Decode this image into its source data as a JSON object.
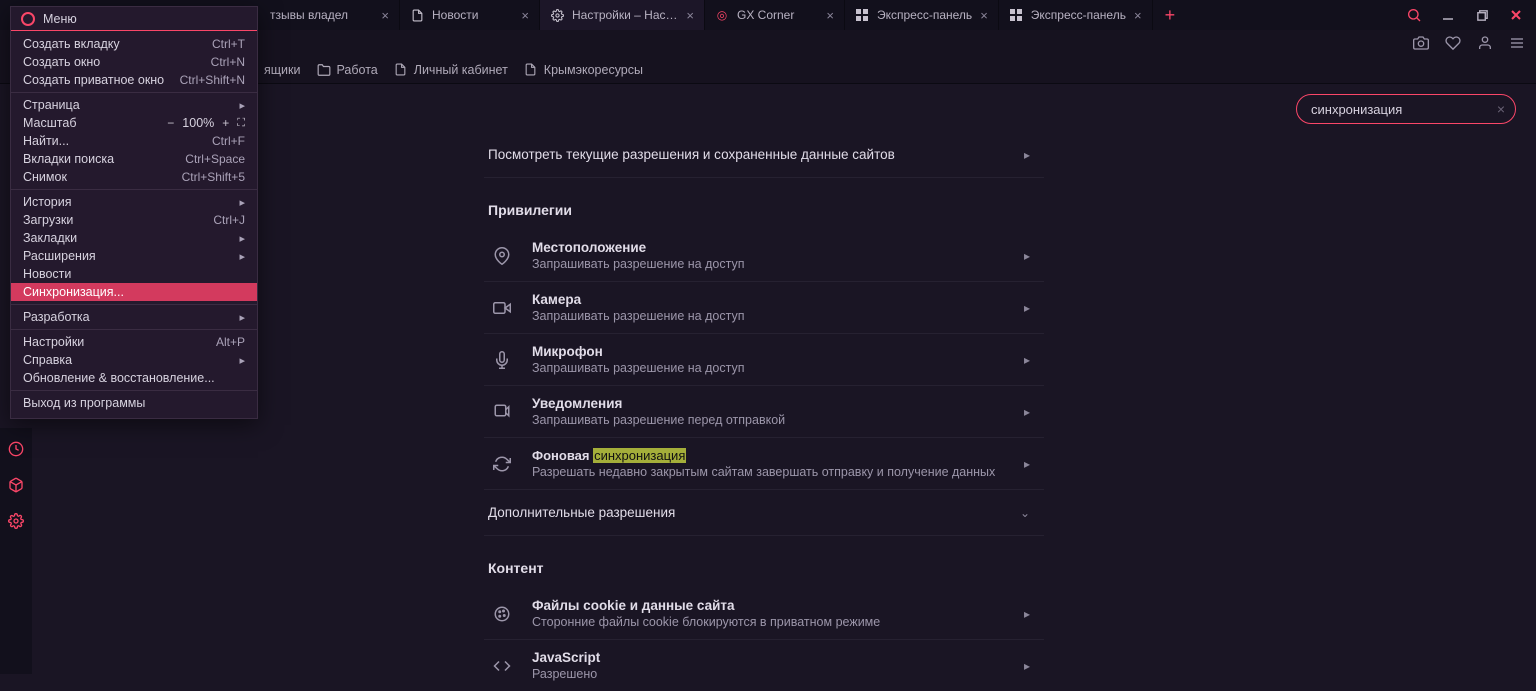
{
  "tabs": [
    {
      "title": "тзывы владел",
      "icon": "page"
    },
    {
      "title": "Новости",
      "icon": "page"
    },
    {
      "title": "Настройки – Настройки с",
      "icon": "gear",
      "active": true
    },
    {
      "title": "GX Corner",
      "icon": "gx"
    },
    {
      "title": "Экспресс-панель",
      "icon": "speeddial"
    },
    {
      "title": "Экспресс-панель",
      "icon": "speeddial"
    }
  ],
  "bookmarks": {
    "b0": "ящики",
    "b1": "Работа",
    "b2": "Личный кабинет",
    "b3": "Крымэкоресурсы"
  },
  "search": {
    "value": "синхронизация"
  },
  "settings": {
    "perm_link": "Посмотреть текущие разрешения и сохраненные данные сайтов",
    "h_priv": "Привилегии",
    "loc_t": "Местоположение",
    "loc_s": "Запрашивать разрешение на доступ",
    "cam_t": "Камера",
    "cam_s": "Запрашивать разрешение на доступ",
    "mic_t": "Микрофон",
    "mic_s": "Запрашивать разрешение на доступ",
    "ntf_t": "Уведомления",
    "ntf_s": "Запрашивать разрешение перед отправкой",
    "bg_pre": "Фоновая ",
    "bg_hl": "синхронизация",
    "bg_s": "Разрешать недавно закрытым сайтам завершать отправку и получение данных",
    "addl": "Дополнительные разрешения",
    "h_cont": "Контент",
    "ck_t": "Файлы cookie и данные сайта",
    "ck_s": "Сторонние файлы cookie блокируются в приватном режиме",
    "js_t": "JavaScript",
    "js_s": "Разрешено"
  },
  "menu": {
    "title": "Меню",
    "new_tab": "Создать вкладку",
    "sc_new_tab": "Ctrl+T",
    "new_win": "Создать окно",
    "sc_new_win": "Ctrl+N",
    "new_priv": "Создать приватное окно",
    "sc_new_priv": "Ctrl+Shift+N",
    "page": "Страница",
    "zoom_lbl": "Масштаб",
    "zoom_val": "100%",
    "find": "Найти...",
    "sc_find": "Ctrl+F",
    "searchtabs": "Вкладки поиска",
    "sc_searchtabs": "Ctrl+Space",
    "snapshot": "Снимок",
    "sc_snapshot": "Ctrl+Shift+5",
    "history": "История",
    "downloads": "Загрузки",
    "sc_downloads": "Ctrl+J",
    "bookmarks": "Закладки",
    "extensions": "Расширения",
    "news": "Новости",
    "sync": "Синхронизация...",
    "dev": "Разработка",
    "settings": "Настройки",
    "sc_settings": "Alt+P",
    "help": "Справка",
    "update": "Обновление & восстановление...",
    "exit": "Выход из программы"
  }
}
